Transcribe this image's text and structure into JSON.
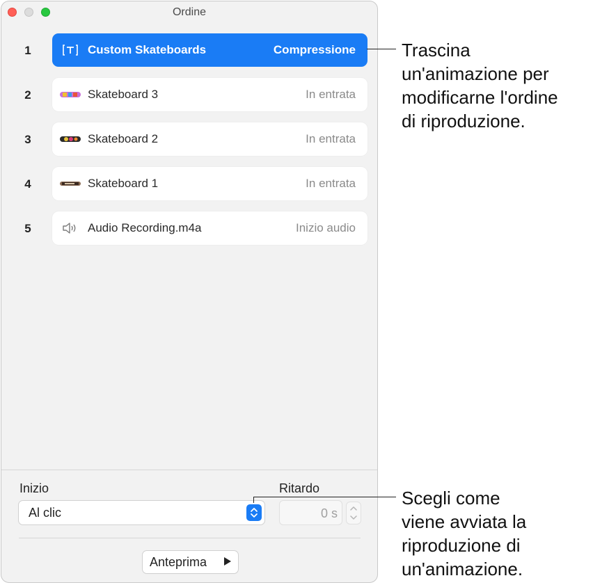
{
  "window": {
    "title": "Ordine"
  },
  "animations": [
    {
      "index": "1",
      "name": "Custom Skateboards",
      "effect": "Compressione",
      "icon": "textbox-icon",
      "selected": true
    },
    {
      "index": "2",
      "name": "Skateboard 3",
      "effect": "In entrata",
      "icon": "skateboard-3-thumbnail"
    },
    {
      "index": "3",
      "name": "Skateboard 2",
      "effect": "In entrata",
      "icon": "skateboard-2-thumbnail"
    },
    {
      "index": "4",
      "name": "Skateboard 1",
      "effect": "In entrata",
      "icon": "skateboard-1-thumbnail"
    },
    {
      "index": "5",
      "name": "Audio Recording.m4a",
      "effect": "Inizio audio",
      "icon": "speaker-icon"
    }
  ],
  "controls": {
    "start_label": "Inizio",
    "start_value": "Al clic",
    "delay_label": "Ritardo",
    "delay_value": "0 s",
    "preview_label": "Anteprima"
  },
  "callouts": {
    "top": [
      "Trascina",
      "un'animazione per",
      "modificarne l'ordine",
      "di riproduzione."
    ],
    "bottom": [
      "Scegli come",
      "viene avviata la",
      "riproduzione di",
      "un'animazione."
    ]
  },
  "colors": {
    "accent": "#1a7cf5",
    "close": "#ff5f57",
    "zoom": "#28c840"
  }
}
